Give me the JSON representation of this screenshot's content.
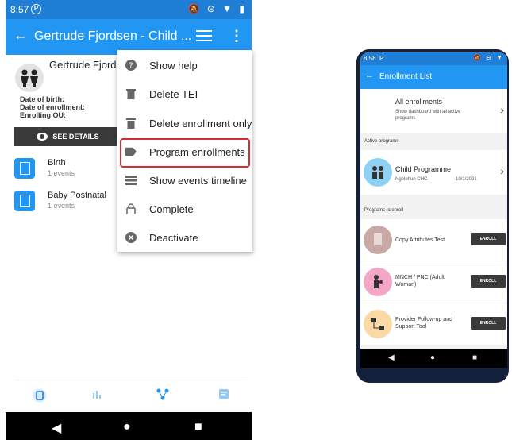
{
  "left_phone": {
    "status": {
      "time": "8:57",
      "p": "P",
      "right_icons": "🔕 ⊝ ▼ ▮"
    },
    "appbar": {
      "back": "←",
      "title": "Gertrude Fjordsen - Child ...",
      "more": "⋮"
    },
    "tei": {
      "name": "Gertrude Fjords",
      "labels": [
        "Date of birth:",
        "Date of enrollment:",
        "Enrolling OU:"
      ],
      "see_details": "SEE DETAILS"
    },
    "stages": [
      {
        "name": "Birth",
        "count": "1 events"
      },
      {
        "name": "Baby Postnatal",
        "count": "1 events"
      }
    ],
    "menu": [
      {
        "label": "Show help",
        "icon": "help-icon",
        "glyph": "?"
      },
      {
        "label": "Delete TEI",
        "icon": "trash-icon",
        "glyph": "🗑"
      },
      {
        "label": "Delete enrollment only",
        "icon": "trash-icon",
        "glyph": "🗑"
      },
      {
        "label": "Program enrollments",
        "icon": "label-icon",
        "glyph": "▰"
      },
      {
        "label": "Show events timeline",
        "icon": "list-icon",
        "glyph": "☰"
      },
      {
        "label": "Complete",
        "icon": "lock-icon",
        "glyph": "🔒"
      },
      {
        "label": "Deactivate",
        "icon": "cancel-icon",
        "glyph": "✖"
      }
    ],
    "bottom_nav": [
      "event-list-icon",
      "analytics-icon",
      "relationships-icon",
      "notes-icon"
    ],
    "system_nav": {
      "back": "◀",
      "home": "●",
      "recent": "■"
    }
  },
  "right_phone": {
    "status": {
      "time": "8:58",
      "p": "P",
      "right_icons": "🔕 ⊝ ▼"
    },
    "appbar": {
      "back": "←",
      "title": "Enrollment List"
    },
    "all_enrollments": {
      "title": "All enrollments",
      "subtitle": "Show dashboard with all active programs",
      "chevron": "›"
    },
    "active_section": "Active programs",
    "active": {
      "name": "Child Programme",
      "org": "Ngelehun CHC",
      "date": "10/1/2021",
      "chevron": "›"
    },
    "enroll_section": "Programs to enroll",
    "to_enroll": [
      {
        "name": "Copy Attributes Test",
        "button": "ENROLL",
        "color": "#c9a9a6"
      },
      {
        "name": "MNCH / PNC (Adult Woman)",
        "button": "ENROLL",
        "color": "#f4a6c6"
      },
      {
        "name": "Provider Follow-up and Support Tool",
        "button": "ENROLL",
        "color": "#fbd9a5"
      }
    ],
    "system_nav": {
      "back": "◀",
      "home": "●",
      "recent": "■"
    }
  },
  "colors": {
    "primary": "#2196f3",
    "status_bar": "#1f7ed6",
    "highlight": "#d32f2f"
  }
}
